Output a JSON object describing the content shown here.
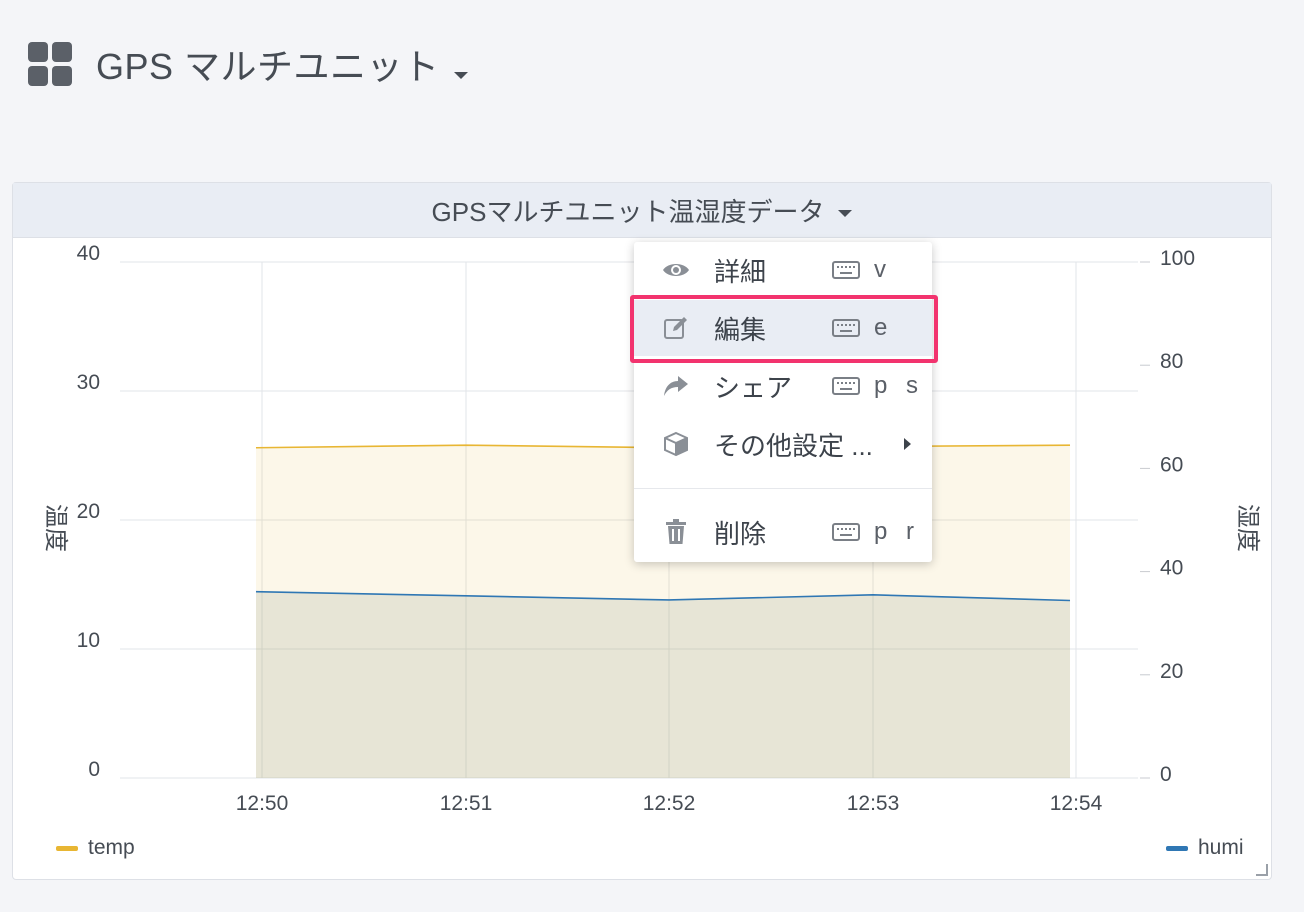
{
  "dashboard": {
    "title": "GPS マルチユニット"
  },
  "panel": {
    "title": "GPSマルチユニット温湿度データ"
  },
  "chart_data": {
    "type": "area",
    "categories": [
      "12:50",
      "12:51",
      "12:52",
      "12:53",
      "12:54"
    ],
    "series": [
      {
        "name": "temp",
        "axis": "left",
        "color": "#e8b633",
        "values": [
          25.6,
          25.8,
          25.6,
          25.7,
          25.8
        ]
      },
      {
        "name": "humi",
        "axis": "right",
        "color": "#2f77b4",
        "values": [
          36.1,
          35.3,
          34.5,
          35.5,
          34.4
        ]
      }
    ],
    "yleft": {
      "label": "温度",
      "ticks": [
        "0",
        "10",
        "20",
        "30",
        "40"
      ],
      "ylim": [
        0,
        40
      ]
    },
    "yright": {
      "label": "湿度",
      "ticks": [
        "0",
        "20",
        "40",
        "60",
        "80",
        "100"
      ],
      "ylim": [
        0,
        100
      ]
    },
    "grid": true,
    "legend": {
      "left": "temp",
      "right": "humi"
    }
  },
  "menu": {
    "items": [
      {
        "label": "詳細",
        "icon": "eye-icon",
        "shortcut": "v"
      },
      {
        "label": "編集",
        "icon": "edit-icon",
        "shortcut": "e"
      },
      {
        "label": "シェア",
        "icon": "share-icon",
        "shortcut": "p s"
      },
      {
        "label": "その他設定 ...",
        "icon": "cube-icon",
        "shortcut": ""
      },
      {
        "label": "削除",
        "icon": "trash-icon",
        "shortcut": "p r"
      }
    ],
    "highlight_color": "#f2336e"
  }
}
